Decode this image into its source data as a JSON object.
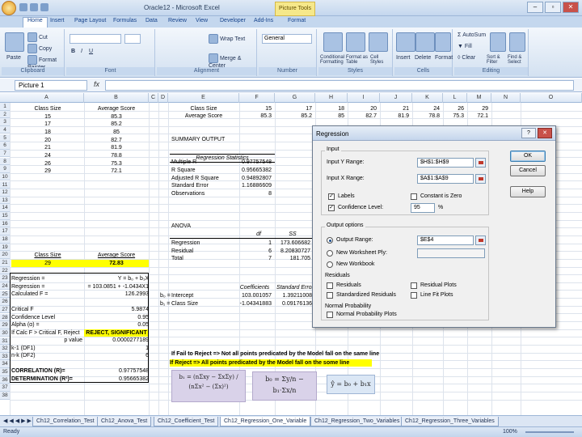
{
  "window": {
    "title": "Oracle12 - Microsoft Excel",
    "context_tab": "Picture Tools",
    "min": "–",
    "max": "▫",
    "close": "✕"
  },
  "tabs": [
    "Home",
    "Insert",
    "Page Layout",
    "Formulas",
    "Data",
    "Review",
    "View",
    "Developer",
    "Add-Ins",
    "Format"
  ],
  "ribbon": {
    "groups": [
      "Clipboard",
      "Font",
      "Alignment",
      "Number",
      "Styles",
      "Cells",
      "Editing"
    ],
    "paste": "Paste",
    "cut": "Cut",
    "copy": "Copy",
    "format_painter": "Format Painter",
    "wrap_text": "Wrap Text",
    "merge_center": "Merge & Center",
    "number_format": "General",
    "cond_fmt": "Conditional Formatting",
    "format_table": "Format as Table",
    "cell_styles": "Cell Styles",
    "insert": "Insert",
    "delete": "Delete",
    "format": "Format",
    "autosum": "AutoSum",
    "fill": "Fill",
    "clear": "Clear",
    "sort_filter": "Sort & Filter",
    "find_select": "Find & Select"
  },
  "formula_bar": {
    "name_box": "Picture 1",
    "fx": "fx",
    "content": ""
  },
  "columns": [
    "A",
    "B",
    "C",
    "D",
    "E",
    "F",
    "G",
    "H",
    "I",
    "J",
    "K",
    "L",
    "M",
    "N",
    "O"
  ],
  "rows": [
    "1",
    "2",
    "3",
    "4",
    "5",
    "6",
    "7",
    "8",
    "9",
    "10",
    "11",
    "12",
    "13",
    "14",
    "15",
    "16",
    "17",
    "18",
    "19",
    "20",
    "21",
    "22",
    "23",
    "24",
    "25",
    "26",
    "27",
    "28",
    "29",
    "30",
    "31",
    "32",
    "33",
    "34",
    "35",
    "36",
    "37",
    "38"
  ],
  "sheet": {
    "a1": "Class Size",
    "b1": "Average Score",
    "data": [
      [
        "15",
        "85.3"
      ],
      [
        "17",
        "85.2"
      ],
      [
        "18",
        "85"
      ],
      [
        "20",
        "82.7"
      ],
      [
        "21",
        "81.9"
      ],
      [
        "24",
        "78.8"
      ],
      [
        "26",
        "75.3"
      ],
      [
        "29",
        "72.1"
      ]
    ],
    "d1": "Class Size",
    "d2": "Average Score",
    "row1_vals": [
      "15",
      "17",
      "18",
      "20",
      "21",
      "24",
      "26",
      "29"
    ],
    "row2_vals": [
      "85.3",
      "85.2",
      "85",
      "82.7",
      "81.9",
      "78.8",
      "75.3",
      "72.1"
    ],
    "summary": "SUMMARY OUTPUT",
    "reg_stats": "Regression Statistics",
    "stats_labels": [
      "Multiple R",
      "R Square",
      "Adjusted R Square",
      "Standard Error",
      "Observations"
    ],
    "stats_values": [
      "0.97757548",
      "0.95665382",
      "0.94892807",
      "1.16886609",
      "8"
    ],
    "anova": "ANOVA",
    "anova_hdr_df": "df",
    "anova_hdr_ss": "SS",
    "anova_rows": [
      [
        "Regression",
        "1",
        "173.606682"
      ],
      [
        "Residual",
        "6",
        "8.20830727"
      ],
      [
        "Total",
        "7",
        "181.705"
      ]
    ],
    "coef_hdr": "Coefficients",
    "se_hdr": "Standard Error",
    "coef_rows": [
      [
        "b₀ =",
        "Intercept",
        "103.001057",
        "1.39211008"
      ],
      [
        "b₁ =",
        "Class Size",
        "-1.04341883",
        "0.09176136"
      ]
    ],
    "a16": "Class Size",
    "b16": "Average Score",
    "a17": "29",
    "b17": "72.83",
    "a19": "Regression =",
    "b19": "Y = b₀ + b₁X",
    "a20": "Regression =",
    "b20": "= 103.0851 + -1.0434X1",
    "a21": "Calculated F =",
    "b21": "126.2993",
    "a23": "Critical F",
    "b23": "5.9874",
    "a24": "Confidence Level",
    "b24": "0.95",
    "a25": "Alpha (α) =",
    "b25": "0.05",
    "a26": "If Calc F > Critical F, Reject",
    "b26": "REJECT, SIGNIFICANT",
    "a27": "p value",
    "b27": "0.0000277189",
    "a28": "k-1 (DF1)",
    "b28": "1",
    "a29": "n-k (DF2)",
    "b29": "6",
    "a31": "CORRELATION (R)=",
    "b31": "0.97757548",
    "a32": "DETERMINATION (R²)=",
    "b32": "0.95665382",
    "note1": "If Fail to Reject => Not all points predicated by the Model fall on the same line",
    "note2": "If Reject => All points predicated by the Model fall on the some line"
  },
  "formulas": {
    "b1": "b₁ = (nΣxy − ΣxΣy) / (nΣx² − (Σx)²)",
    "b0": "b₀ = Σy/n − b₁·Σx/n",
    "yhat": "ŷ = b₀ + b₁x"
  },
  "dialog": {
    "title": "Regression",
    "input": "Input",
    "input_y_label": "Input Y Range:",
    "input_y": "$H$1:$H$9",
    "input_x_label": "Input X Range:",
    "input_x": "$A$1:$A$9",
    "labels": "Labels",
    "constant_zero": "Constant is Zero",
    "confidence_label": "Confidence Level:",
    "confidence": "95",
    "pct": "%",
    "output_options": "Output options",
    "output_range_label": "Output Range:",
    "output_range": "$E$4",
    "new_ply": "New Worksheet Ply:",
    "new_workbook": "New Workbook",
    "residuals": "Residuals",
    "residuals_chk": "Residuals",
    "std_residuals": "Standardized Residuals",
    "residual_plots": "Residual Plots",
    "line_fit": "Line Fit Plots",
    "normal_prob": "Normal Probability",
    "normal_plots": "Normal Probability Plots",
    "ok": "OK",
    "cancel": "Cancel",
    "help": "Help",
    "help_btn": "?",
    "close_btn": "✕"
  },
  "sheet_tabs": [
    "Ch12_Correlation_Test",
    "Ch12_Anova_Test",
    "Ch12_Coefficient_Test",
    "Ch12_Regression_One_Variable",
    "Ch12_Regression_Two_Variables",
    "Ch12_Regression_Three_Variables"
  ],
  "status": {
    "ready": "Ready",
    "zoom": "100%"
  }
}
